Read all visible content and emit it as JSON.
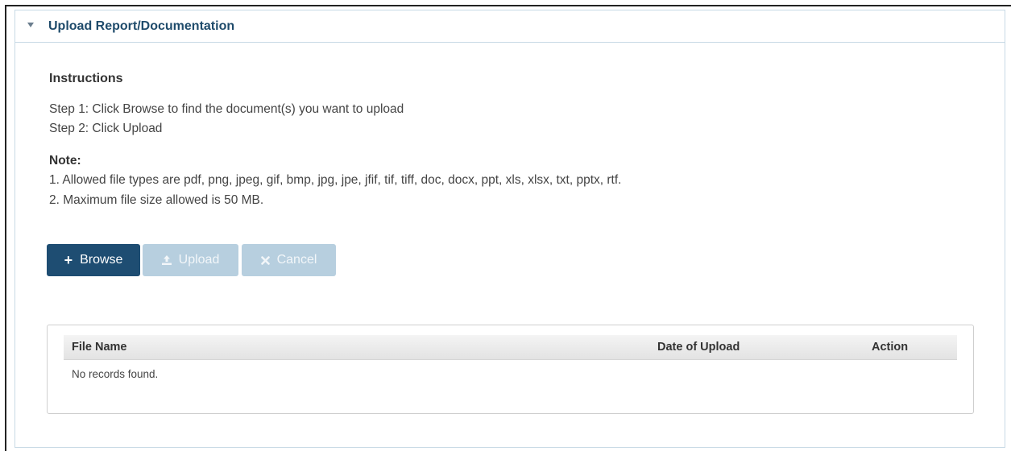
{
  "panel": {
    "title": "Upload Report/Documentation"
  },
  "instructions": {
    "heading": "Instructions",
    "step1": "Step 1: Click Browse to find the document(s) you want to upload",
    "step2": "Step 2: Click Upload"
  },
  "note": {
    "heading": "Note:",
    "line1": "1. Allowed file types are pdf, png, jpeg, gif, bmp, jpg, jpe, jfif, tif, tiff, doc, docx, ppt, xls, xlsx, txt, pptx, rtf.",
    "line2": "2. Maximum file size allowed is 50 MB."
  },
  "buttons": {
    "browse_label": "Browse",
    "upload_label": "Upload",
    "cancel_label": "Cancel",
    "browse_icon": "plus-icon",
    "upload_icon": "upload-icon",
    "cancel_icon": "close-icon",
    "upload_enabled": false,
    "cancel_enabled": false
  },
  "table": {
    "columns": [
      "File Name",
      "Date of Upload",
      "Action"
    ],
    "empty_message": "No records found."
  },
  "colors": {
    "primary": "#1e4d72",
    "disabled": "#b7cfdf",
    "title": "#1f4b6b",
    "border": "#c7d9e5"
  }
}
